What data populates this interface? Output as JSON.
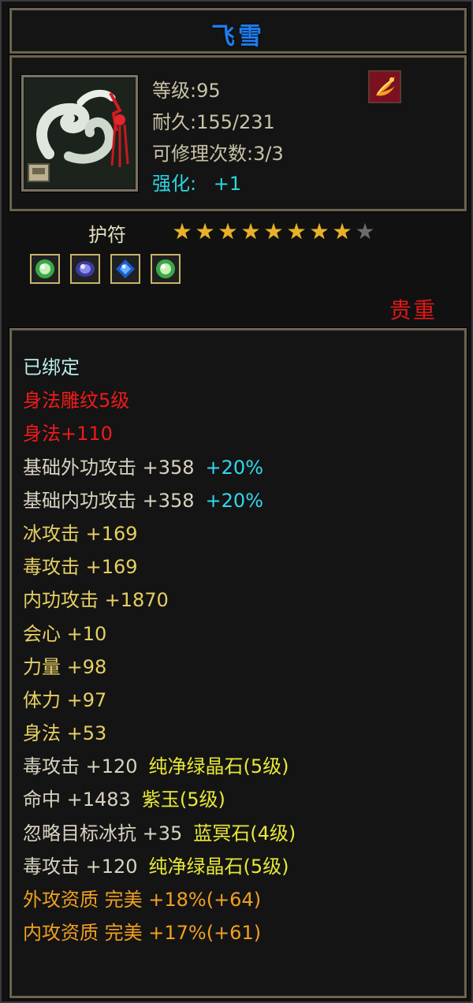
{
  "item": {
    "name": "飞雪",
    "level": "等级:95",
    "durability": "耐久:155/231",
    "repairs": "可修理次数:3/3",
    "enhance_label": "强化:",
    "enhance_value": "+1",
    "type": "护符",
    "stars_total": 9,
    "stars_filled": 8,
    "quality": "贵重",
    "icon": "jade-amulet-icon",
    "tag_icon": "phoenix-badge-icon",
    "gems": [
      {
        "icon": "green-gem-icon"
      },
      {
        "icon": "purple-gem-icon"
      },
      {
        "icon": "blue-gem-icon"
      },
      {
        "icon": "green-gem-icon"
      }
    ]
  },
  "attributes": [
    {
      "text": "已绑定",
      "color": "#b8ece8"
    },
    {
      "text": "身法雕纹5级",
      "color": "#f01a1a"
    },
    {
      "text": "身法+110",
      "color": "#f01a1a"
    },
    {
      "text": "基础外功攻击  +358",
      "extra": "+20%",
      "color": "#d8d2c0",
      "extra_color": "#30d8ee"
    },
    {
      "text": "基础内功攻击  +358",
      "extra": "+20%",
      "color": "#d8d2c0",
      "extra_color": "#30d8ee"
    },
    {
      "text": "冰攻击  +169",
      "color": "#e6cf62"
    },
    {
      "text": "毒攻击  +169",
      "color": "#e6cf62"
    },
    {
      "text": "内功攻击  +1870",
      "color": "#e6cf62"
    },
    {
      "text": "会心  +10",
      "color": "#e6cf62"
    },
    {
      "text": "力量  +98",
      "color": "#e6cf62"
    },
    {
      "text": "体力  +97",
      "color": "#e6cf62"
    },
    {
      "text": "身法  +53",
      "color": "#e6cf62"
    },
    {
      "text": "毒攻击  +120",
      "extra": "纯净绿晶石(5级)",
      "color": "#d8d2c0",
      "extra_color": "#e8e838"
    },
    {
      "text": "命中  +1483",
      "extra": "紫玉(5级)",
      "color": "#d8d2c0",
      "extra_color": "#e8e838"
    },
    {
      "text": "忽略目标冰抗  +35",
      "extra": "蓝冥石(4级)",
      "color": "#d8d2c0",
      "extra_color": "#e8e838"
    },
    {
      "text": "毒攻击  +120",
      "extra": "纯净绿晶石(5级)",
      "color": "#d8d2c0",
      "extra_color": "#e8e838"
    },
    {
      "text": "外攻资质   完美  +18%(+64)",
      "color": "#f0a020"
    },
    {
      "text": "内攻资质   完美  +17%(+61)",
      "color": "#f0a020"
    }
  ]
}
